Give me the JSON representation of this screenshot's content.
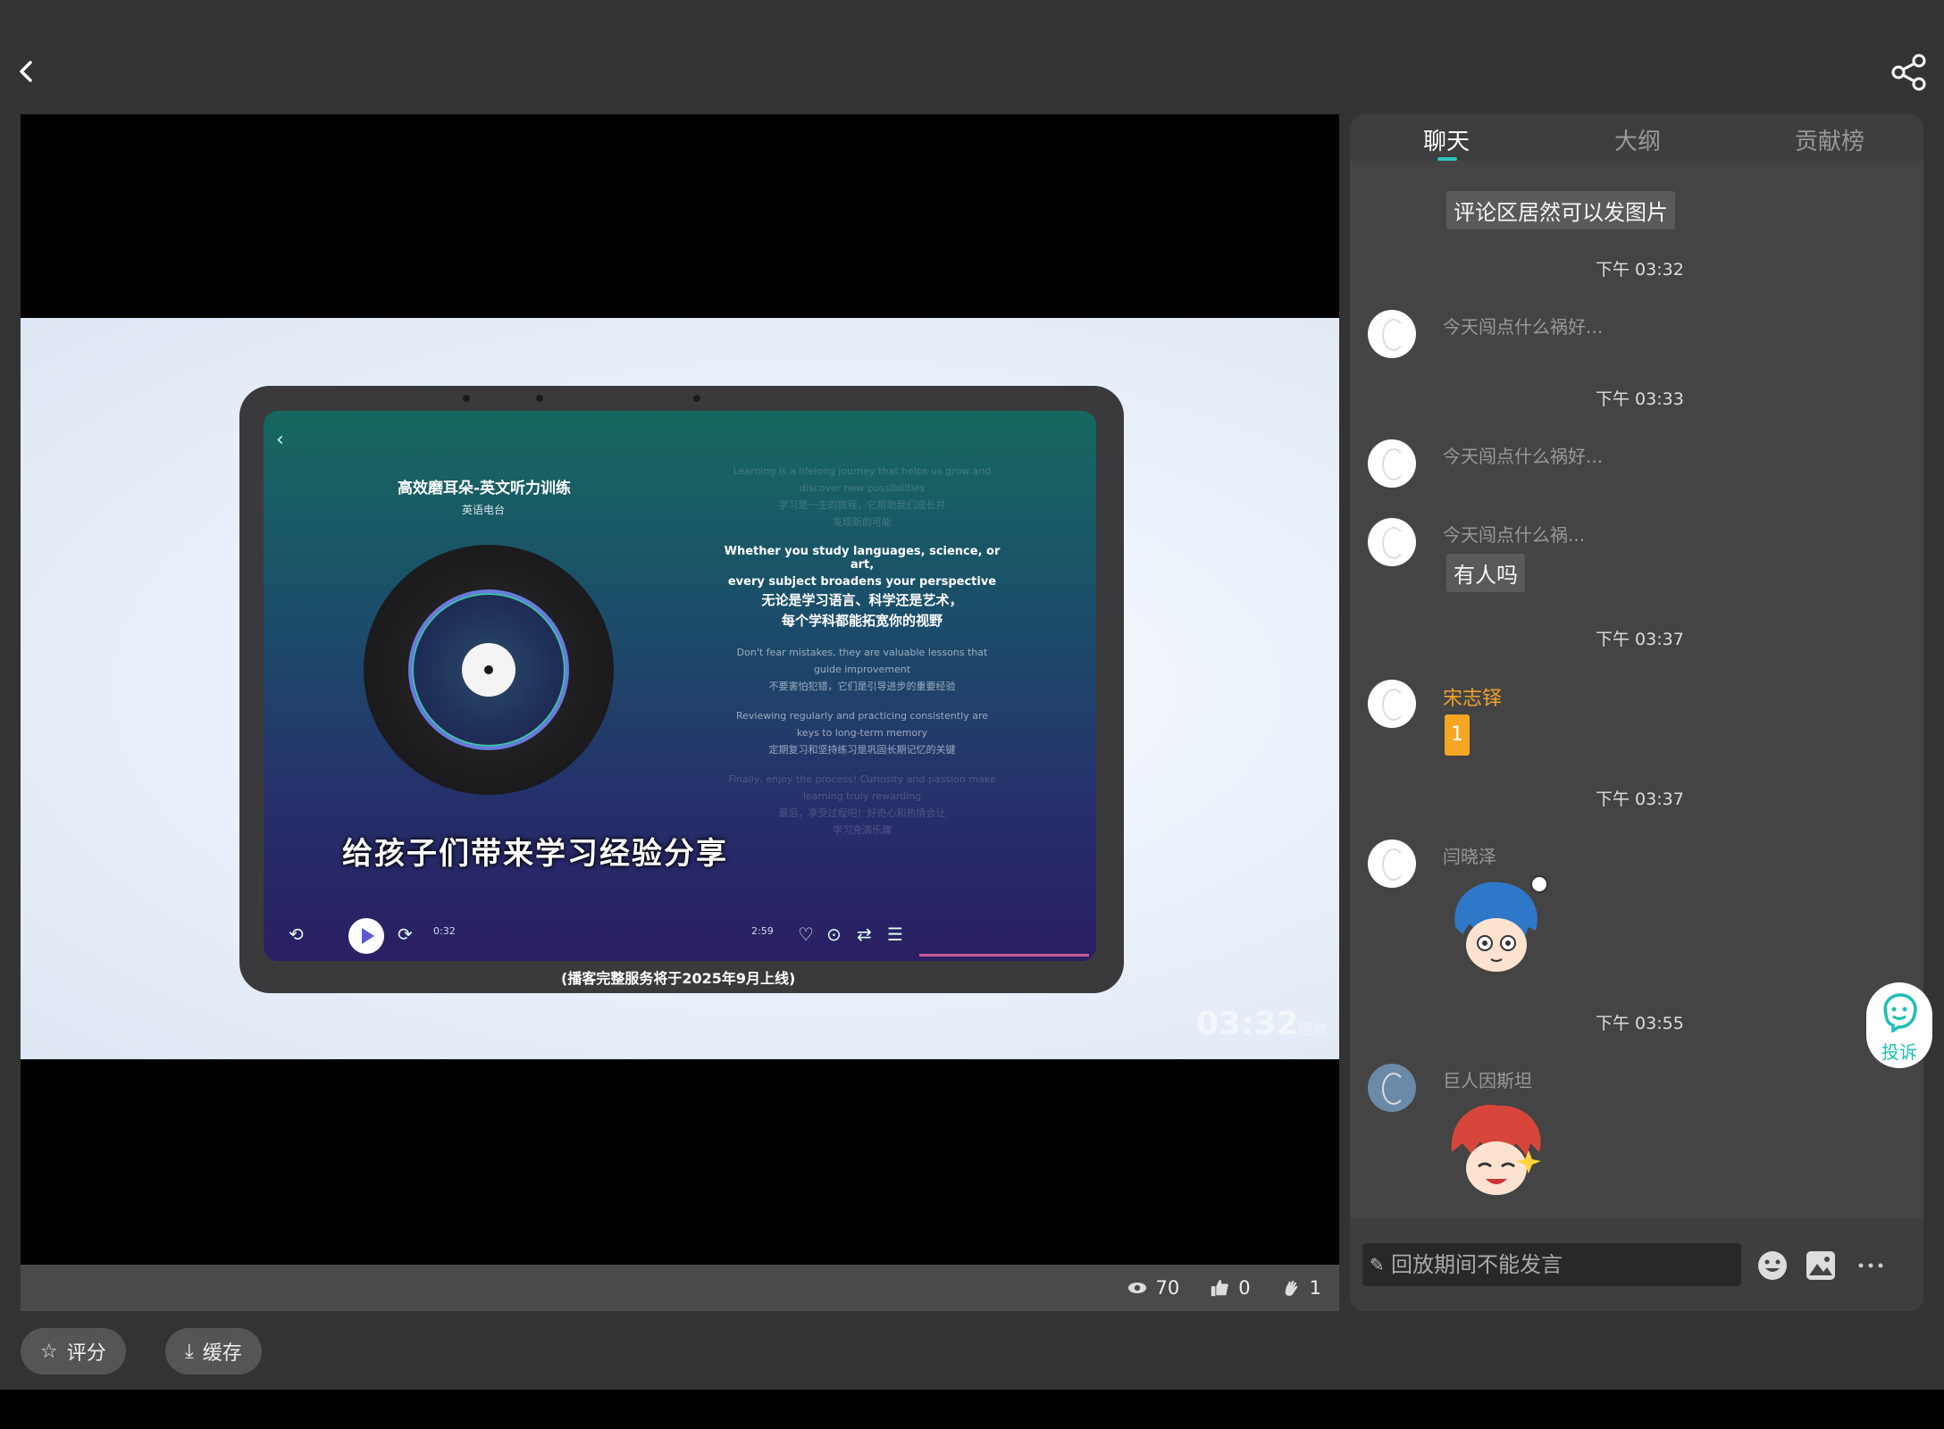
{
  "video": {
    "screen_title": "高效磨耳朵-英文听力训练",
    "screen_subtitle": "英语电台",
    "lyrics": [
      {
        "text": "Learning is a lifelong journey that helps us grow and",
        "style": "faint"
      },
      {
        "text": "discover new possibilities",
        "style": "faint"
      },
      {
        "text": "学习是一生的旅程，它帮助我们成长并",
        "style": "faint"
      },
      {
        "text": "发现新的可能",
        "style": "faint"
      },
      {
        "text": "Whether you study languages, science, or art,",
        "style": "bold"
      },
      {
        "text": "every subject broadens your perspective",
        "style": "bold"
      },
      {
        "text": "无论是学习语言、科学还是艺术，",
        "style": "cn-strong"
      },
      {
        "text": "每个学科都能拓宽你的视野",
        "style": "cn-strong"
      },
      {
        "text": "Don't fear mistakes, they are valuable lessons that",
        "style": "dim"
      },
      {
        "text": "guide improvement",
        "style": "dim"
      },
      {
        "text": "不要害怕犯错，它们是引导进步的重要经验",
        "style": "dim"
      },
      {
        "text": "Reviewing regularly and practicing consistently are",
        "style": "dim"
      },
      {
        "text": "keys to long-term memory",
        "style": "dim"
      },
      {
        "text": "定期复习和坚持练习是巩固长期记忆的关键",
        "style": "dim"
      },
      {
        "text": "Finally, enjoy the process! Curiosity and passion make",
        "style": "faint"
      },
      {
        "text": "learning truly rewarding",
        "style": "faint"
      },
      {
        "text": "最后，享受过程吧！好奇心和热情会让",
        "style": "faint"
      },
      {
        "text": "学习充满乐趣",
        "style": "faint"
      }
    ],
    "time_current": "0:32",
    "time_total": "2:59",
    "caption": "给孩子们带来学习经验分享",
    "subcaption": "(播客完整服务将于2025年9月上线)",
    "watermark_time": "03:32",
    "watermark_tag": "回放"
  },
  "stats": {
    "views": "70",
    "likes": "0",
    "claps": "1"
  },
  "actions": {
    "rate": "评分",
    "cache": "缓存"
  },
  "tabs": [
    "聊天",
    "大纲",
    "贡献榜"
  ],
  "chat": {
    "top_bubble": "评论区居然可以发图片",
    "times": [
      "下午 03:32",
      "下午 03:33",
      "下午 03:37",
      "下午 03:37",
      "下午 03:55"
    ],
    "preview_1": "今天闯点什么祸好...",
    "preview_2": "今天闯点什么祸好...",
    "preview_3": "今天闯点什么祸...",
    "reply_bubble": "有人吗",
    "user_vip": "宋志铎",
    "vip_msg": "1",
    "user_a": "闫晓泽",
    "user_b": "巨人因斯坦",
    "input_placeholder": "回放期间不能发言"
  },
  "complain_label": "投诉",
  "colors": {
    "accent": "#2ec3c0",
    "vip": "#f1a12a",
    "badge": "#f6a623"
  }
}
